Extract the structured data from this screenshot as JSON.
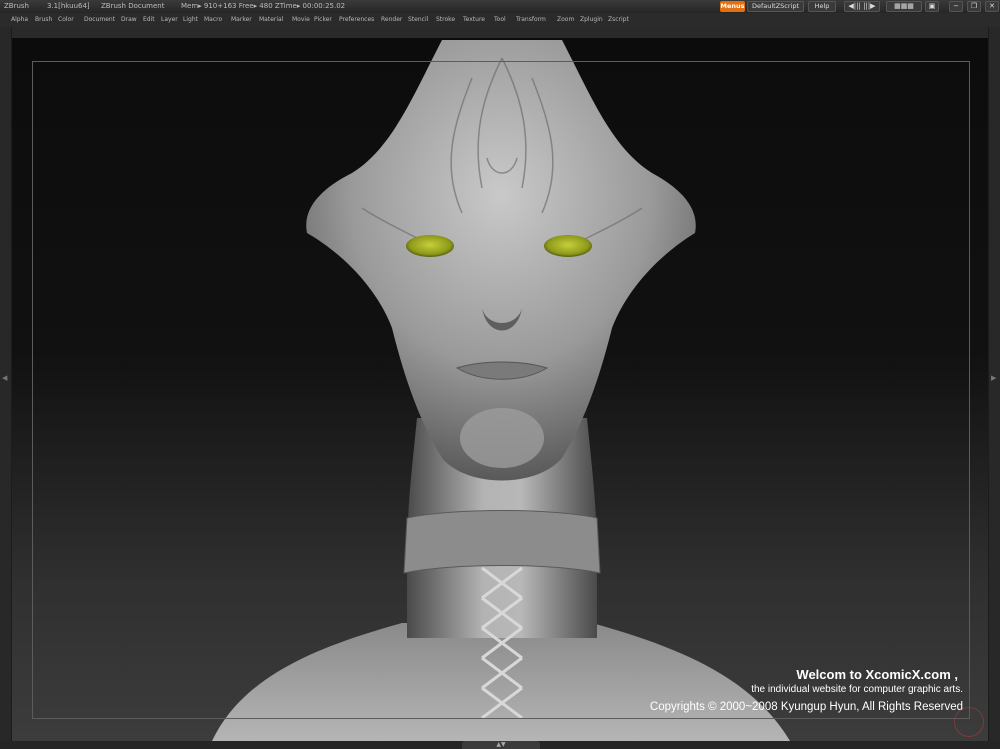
{
  "titlebar": {
    "app": "ZBrush",
    "version": "3.1[hkuu64]",
    "document": "ZBrush Document",
    "mem": "Mem▸ 910+163 Free▸ 480 ZTime▸ 00:00:25.02",
    "menus_button": "Menus",
    "script_button": "DefaultZScript",
    "help_button": "Help"
  },
  "menus": [
    "Alpha",
    "Brush",
    "Color",
    "Document",
    "Draw",
    "Edit",
    "Layer",
    "Light",
    "Macro",
    "Marker",
    "Material",
    "Movie",
    "Picker",
    "Preferences",
    "Render",
    "Stencil",
    "Stroke",
    "Texture",
    "Tool",
    "Transform",
    "Zoom",
    "Zplugin",
    "Zscript"
  ],
  "credits": {
    "line1": "Welcom to XcomicX.com ,",
    "line2": "the individual website for computer graphic arts.",
    "line3": "Copyrights © 2000~2008 Kyungup Hyun, All Rights Reserved"
  },
  "colors": {
    "accent": "#e36f10",
    "eyes": "#8f9a1a",
    "sculpt": "#9a9a9a"
  }
}
